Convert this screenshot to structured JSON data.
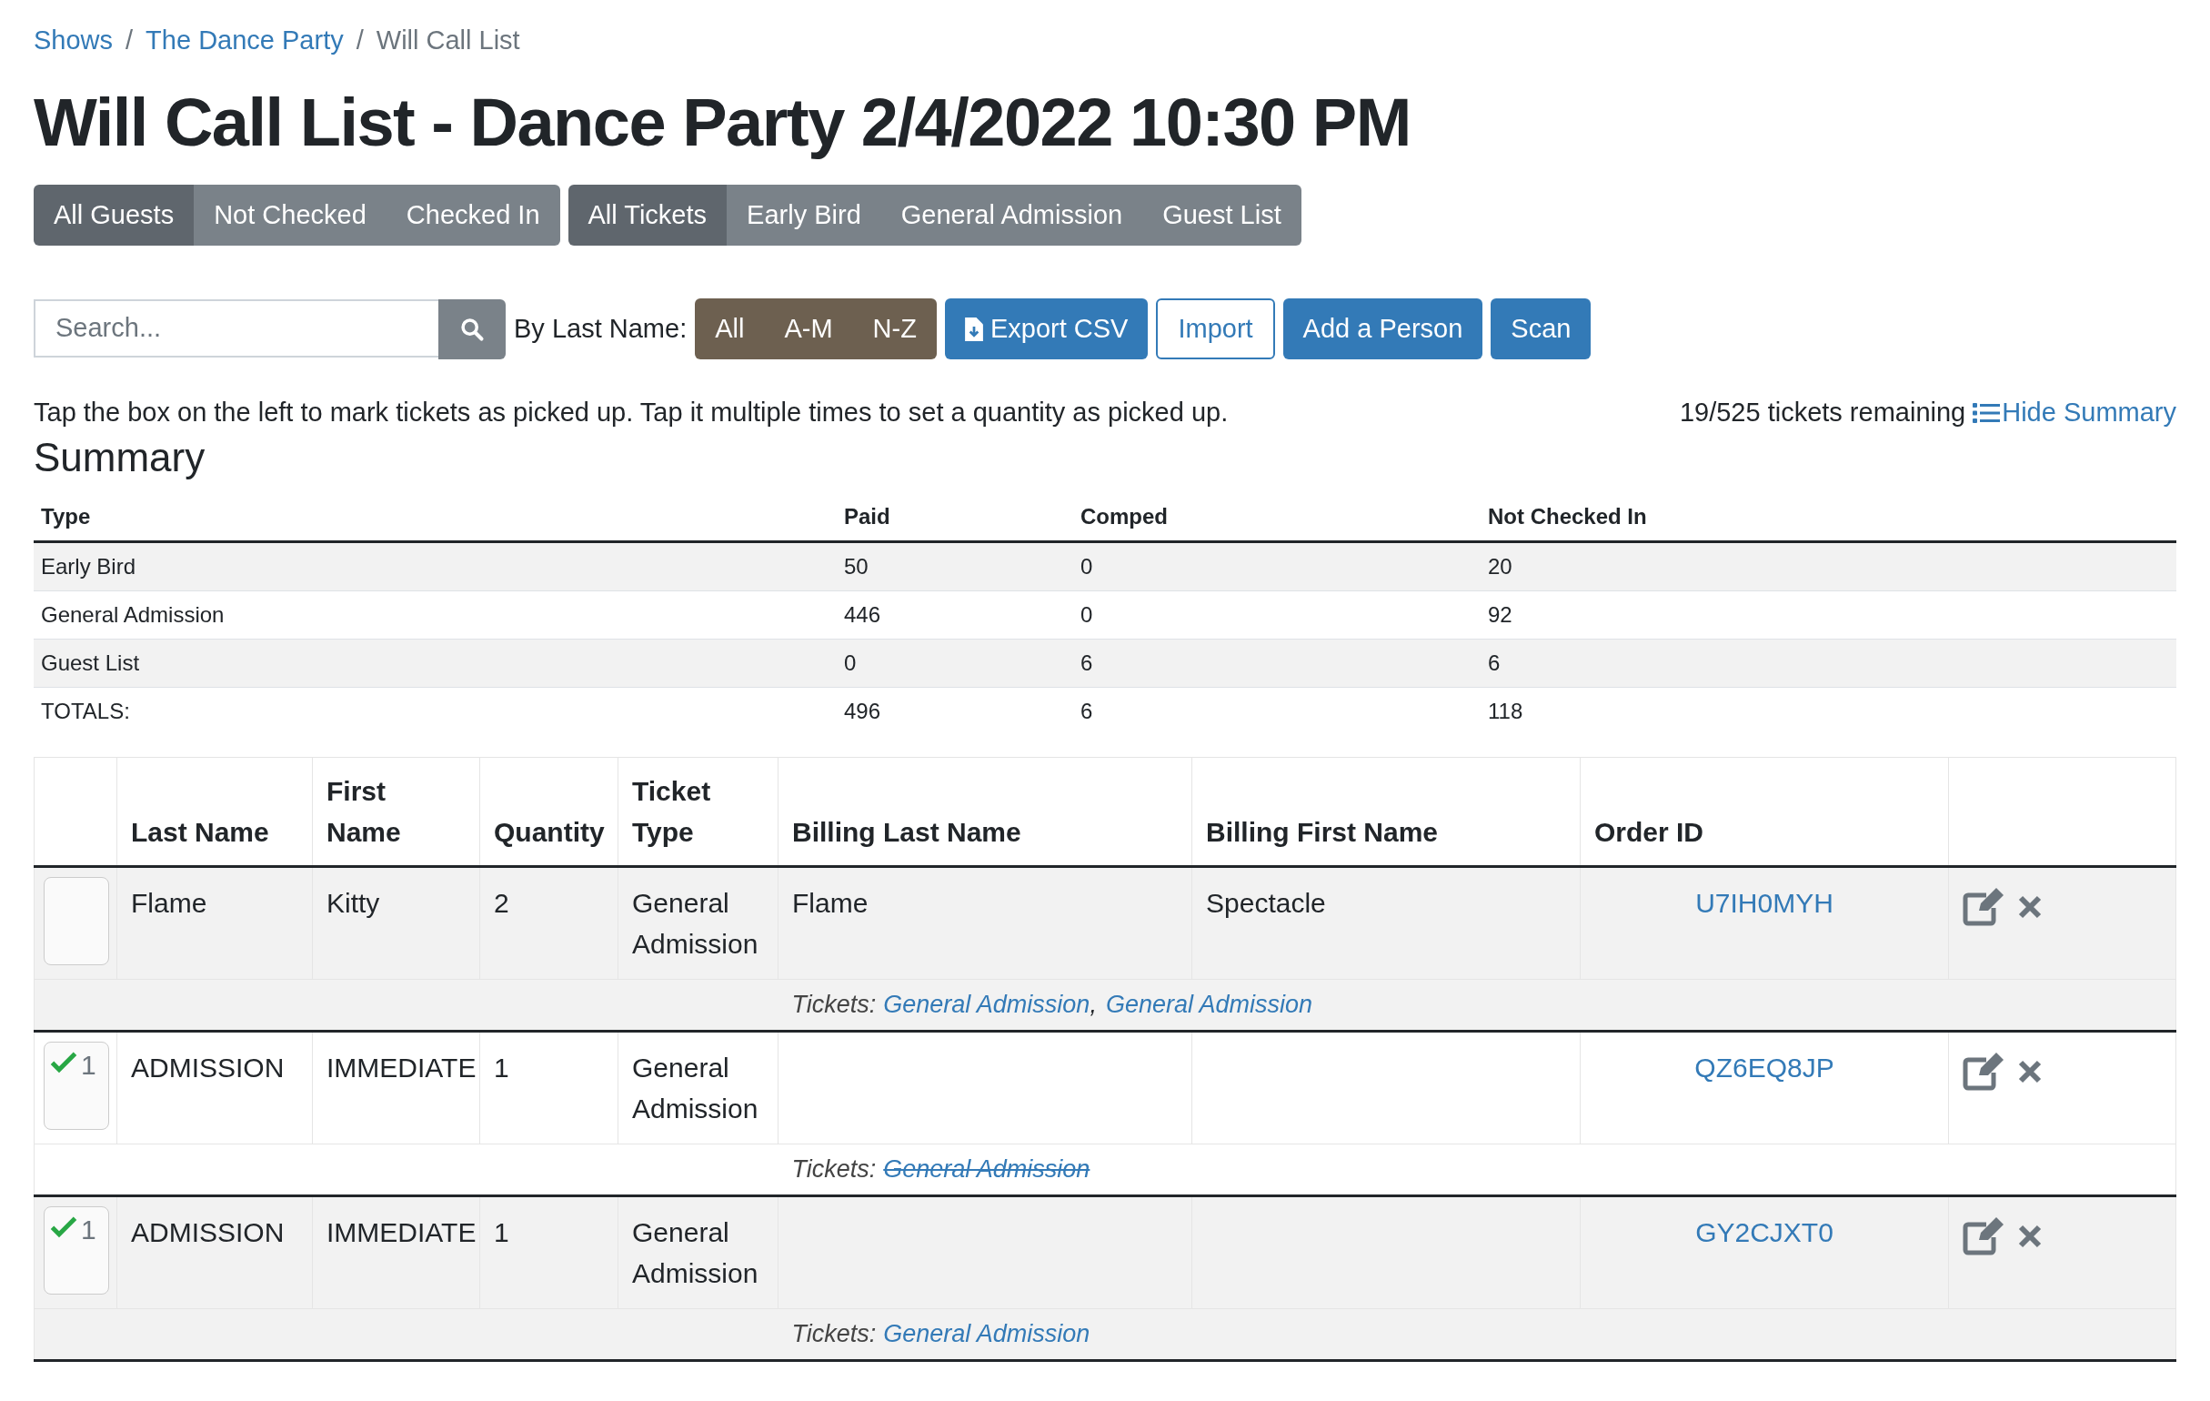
{
  "breadcrumb": [
    {
      "label": "Shows",
      "kind": "link"
    },
    {
      "label": "/",
      "kind": "separator"
    },
    {
      "label": "The Dance Party",
      "kind": "link"
    },
    {
      "label": "/",
      "kind": "separator"
    },
    {
      "label": "Will Call List",
      "kind": "current"
    }
  ],
  "title": "Will Call List - Dance Party 2/4/2022 10:30 PM",
  "guest_filters": [
    {
      "label": "All Guests",
      "selected": true
    },
    {
      "label": "Not Checked",
      "selected": false
    },
    {
      "label": "Checked In",
      "selected": false
    }
  ],
  "ticket_filters": [
    {
      "label": "All Tickets",
      "selected": true
    },
    {
      "label": "Early Bird",
      "selected": false
    },
    {
      "label": "General Admission",
      "selected": false
    },
    {
      "label": "Guest List",
      "selected": false
    }
  ],
  "search": {
    "placeholder": "Search..."
  },
  "last_name_label": "By Last Name:",
  "last_name_filters": [
    {
      "label": "All",
      "selected": false
    },
    {
      "label": "A-M",
      "selected": false
    },
    {
      "label": "N-Z",
      "selected": false
    }
  ],
  "actions": [
    {
      "label": "Export CSV",
      "kind": "export"
    },
    {
      "label": "Import",
      "kind": "outline"
    },
    {
      "label": "Add a Person",
      "kind": "primary"
    },
    {
      "label": "Scan",
      "kind": "primary"
    }
  ],
  "instructions": "Tap the box on the left to mark tickets as picked up. Tap it multiple times to set a quantity as picked up.",
  "remaining": "19/525 tickets remaining",
  "summary_toggle": "Hide Summary",
  "summary": {
    "title": "Summary",
    "columns": [
      "Type",
      "Paid",
      "Comped",
      "Not Checked In"
    ],
    "rows": [
      [
        "Early Bird",
        "50",
        "0",
        "20"
      ],
      [
        "General Admission",
        "446",
        "0",
        "92"
      ],
      [
        "Guest List",
        "0",
        "6",
        "6"
      ],
      [
        "TOTALS:",
        "496",
        "6",
        "118"
      ]
    ]
  },
  "guests": {
    "columns": [
      "Last Name",
      "First Name",
      "Quantity",
      "Ticket Type",
      "Billing Last Name",
      "Billing First Name",
      "Order ID"
    ],
    "rows": [
      {
        "checked": false,
        "count": "",
        "last_name": "Flame",
        "first_name": "Kitty",
        "quantity": "2",
        "ticket_type": "General Admission",
        "billing_last": "Flame",
        "billing_first": "Spectacle",
        "order_id": "U7IH0MYH",
        "tickets": [
          {
            "kind": "label",
            "label": "Tickets:"
          },
          {
            "kind": "ticket",
            "label": "General Admission",
            "picked_up": false
          },
          {
            "kind": "separator",
            "label": ","
          },
          {
            "kind": "ticket",
            "label": "General Admission",
            "picked_up": false
          }
        ]
      },
      {
        "checked": true,
        "count": "1",
        "last_name": "ADMISSION",
        "first_name": "IMMEDIATE",
        "quantity": "1",
        "ticket_type": "General Admission",
        "billing_last": "",
        "billing_first": "",
        "order_id": "QZ6EQ8JP",
        "tickets": [
          {
            "kind": "label",
            "label": "Tickets:"
          },
          {
            "kind": "ticket",
            "label": "General Admission",
            "picked_up": true
          }
        ]
      },
      {
        "checked": true,
        "count": "1",
        "last_name": "ADMISSION",
        "first_name": "IMMEDIATE",
        "quantity": "1",
        "ticket_type": "General Admission",
        "billing_last": "",
        "billing_first": "",
        "order_id": "GY2CJXT0",
        "tickets": [
          {
            "kind": "label",
            "label": "Tickets:"
          },
          {
            "kind": "ticket",
            "label": "General Admission",
            "picked_up": false
          }
        ]
      }
    ]
  }
}
